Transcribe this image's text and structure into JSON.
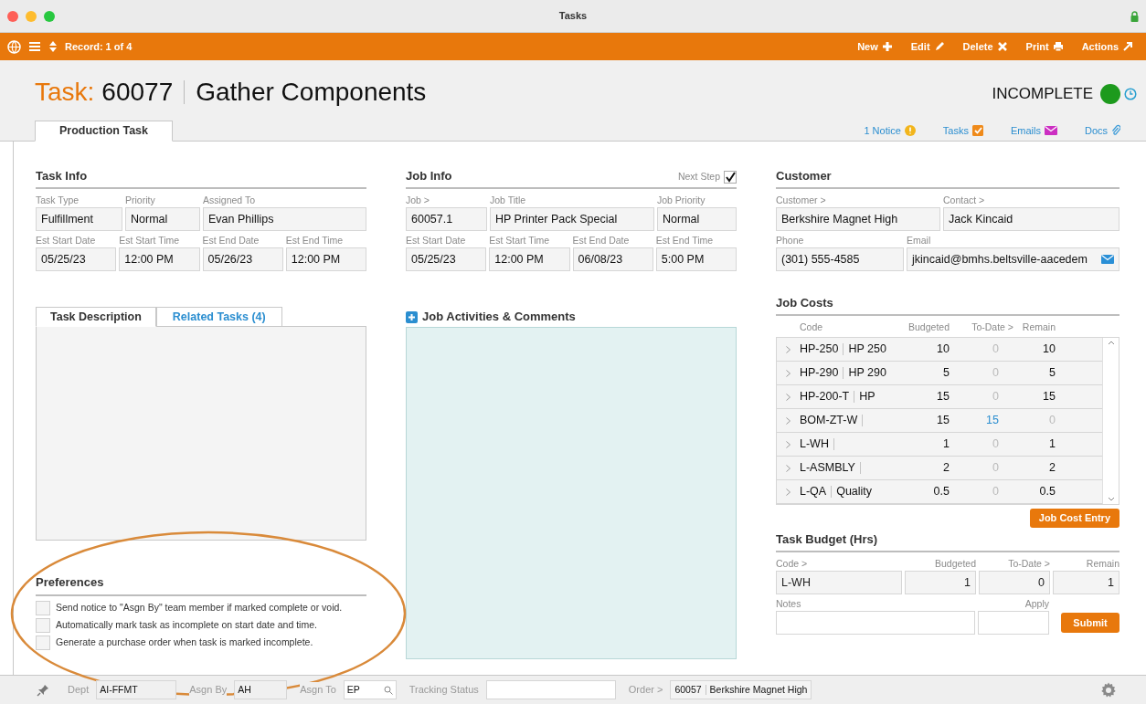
{
  "window": {
    "title": "Tasks"
  },
  "toolbar": {
    "record": "Record: 1 of 4",
    "actions": [
      {
        "label": "New",
        "kind": "new"
      },
      {
        "label": "Edit",
        "kind": "edit"
      },
      {
        "label": "Delete",
        "kind": "delete"
      },
      {
        "label": "Print",
        "kind": "print"
      },
      {
        "label": "Actions",
        "kind": "actions"
      }
    ]
  },
  "header": {
    "prefix": "Task:",
    "number": "60077",
    "title": "Gather Components",
    "status": "INCOMPLETE"
  },
  "tabs": [
    {
      "label": "Production Task",
      "selected": true
    }
  ],
  "links": [
    {
      "label": "1 Notice",
      "kind": "notice"
    },
    {
      "label": "Tasks",
      "kind": "tasks"
    },
    {
      "label": "Emails",
      "kind": "emails"
    },
    {
      "label": "Docs",
      "kind": "docs"
    }
  ],
  "task_info": {
    "title": "Task Info",
    "fields": [
      {
        "label": "Task Type",
        "value": "Fulfillment"
      },
      {
        "label": "Priority",
        "value": "Normal"
      },
      {
        "label": "Assigned To",
        "value": "Evan Phillips"
      },
      {
        "label": "Est Start Date",
        "value": "05/25/23"
      },
      {
        "label": "Est Start Time",
        "value": "12:00 PM"
      },
      {
        "label": "Est End Date",
        "value": "05/26/23"
      },
      {
        "label": "Est End Time",
        "value": "12:00 PM"
      }
    ]
  },
  "job_info": {
    "title": "Job Info",
    "next_step": {
      "label": "Next Step",
      "checked": true
    },
    "fields": [
      {
        "label": "Job >",
        "value": "60057.1"
      },
      {
        "label": "Job Title",
        "value": "HP Printer Pack Special"
      },
      {
        "label": "Job Priority",
        "value": "Normal"
      },
      {
        "label": "Est Start Date",
        "value": "05/25/23"
      },
      {
        "label": "Est Start Time",
        "value": "12:00 PM"
      },
      {
        "label": "Est End Date",
        "value": "06/08/23"
      },
      {
        "label": "Est End Time",
        "value": "5:00 PM"
      }
    ]
  },
  "customer": {
    "title": "Customer",
    "fields": [
      {
        "label": "Customer >",
        "value": "Berkshire Magnet High",
        "kind": "text"
      },
      {
        "label": "Contact >",
        "value": "Jack Kincaid",
        "kind": "text"
      },
      {
        "label": "Phone",
        "value": "(301) 555-4585",
        "kind": "text"
      },
      {
        "label": "Email",
        "value": "jkincaid@bmhs.beltsville-aacedem",
        "kind": "email"
      }
    ]
  },
  "description_tabs": [
    {
      "label": "Task Description",
      "selected": true
    },
    {
      "label": "Related Tasks (4)",
      "selected": false
    }
  ],
  "activities": {
    "title": "Job Activities & Comments"
  },
  "preferences": {
    "title": "Preferences",
    "items": [
      {
        "label": "Send notice to \"Asgn By\" team member if marked complete or void.",
        "checked": false
      },
      {
        "label": "Automatically mark task as incomplete on start date and time.",
        "checked": false
      },
      {
        "label": "Generate a purchase order when task is marked incomplete.",
        "checked": false
      }
    ]
  },
  "job_costs": {
    "title": "Job Costs",
    "columns": [
      "Code",
      "Budgeted",
      "To-Date >",
      "Remain"
    ],
    "rows": [
      {
        "code": "HP-250",
        "name": "HP 250",
        "budgeted": "10",
        "to_date": "0",
        "remain": "10",
        "to_date_linked": false,
        "remain_muted": false
      },
      {
        "code": "HP-290",
        "name": "HP 290",
        "budgeted": "5",
        "to_date": "0",
        "remain": "5",
        "to_date_linked": false,
        "remain_muted": false
      },
      {
        "code": "HP-200-T",
        "name": "HP",
        "budgeted": "15",
        "to_date": "0",
        "remain": "15",
        "to_date_linked": false,
        "remain_muted": false
      },
      {
        "code": "BOM-ZT-W",
        "name": "",
        "budgeted": "15",
        "to_date": "15",
        "remain": "0",
        "to_date_linked": true,
        "remain_muted": true
      },
      {
        "code": "L-WH",
        "name": "",
        "budgeted": "1",
        "to_date": "0",
        "remain": "1",
        "to_date_linked": false,
        "remain_muted": false
      },
      {
        "code": "L-ASMBLY",
        "name": "",
        "budgeted": "2",
        "to_date": "0",
        "remain": "2",
        "to_date_linked": false,
        "remain_muted": false
      },
      {
        "code": "L-QA",
        "name": "Quality",
        "budgeted": "0.5",
        "to_date": "0",
        "remain": "0.5",
        "to_date_linked": false,
        "remain_muted": false
      }
    ],
    "button": "Job Cost Entry"
  },
  "task_budget": {
    "title": "Task Budget (Hrs)",
    "fields": [
      {
        "label": "Code >",
        "value": "L-WH"
      },
      {
        "label": "Budgeted",
        "value": "1"
      },
      {
        "label": "To-Date >",
        "value": "0"
      },
      {
        "label": "Remain",
        "value": "1"
      }
    ],
    "notes_label": "Notes",
    "apply_label": "Apply",
    "button": "Submit"
  },
  "footer": {
    "dept": {
      "label": "Dept",
      "value": "AI-FFMT"
    },
    "asgn_by": {
      "label": "Asgn By",
      "value": "AH"
    },
    "asgn_to": {
      "label": "Asgn To",
      "value": "EP"
    },
    "tracking": {
      "label": "Tracking Status"
    },
    "order": {
      "label": "Order >",
      "number": "60057",
      "name": "Berkshire Magnet High"
    }
  }
}
